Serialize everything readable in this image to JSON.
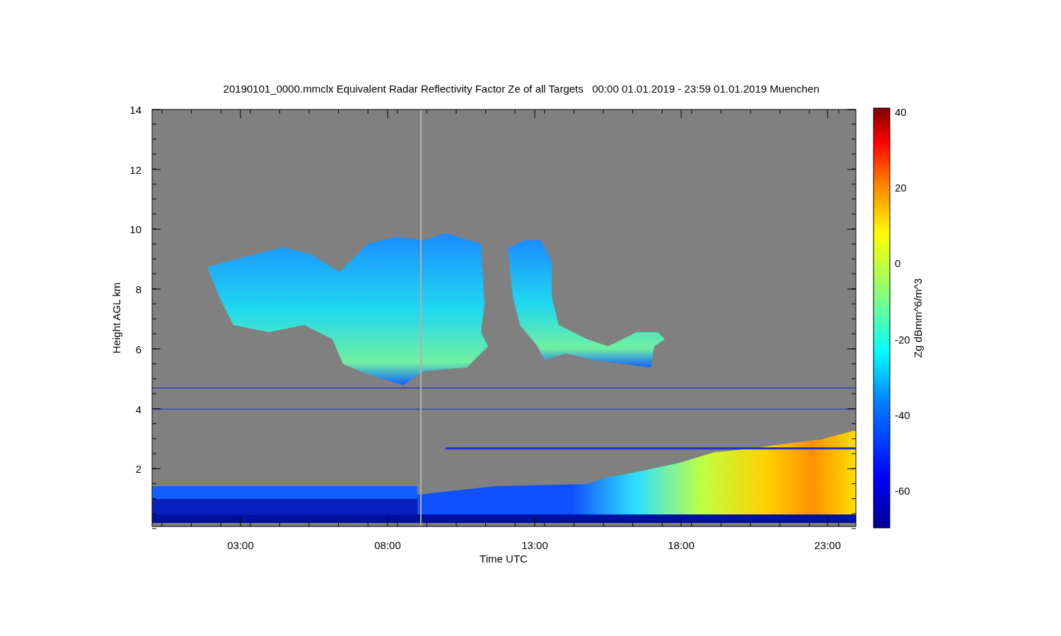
{
  "title": "20190101_0000.mmclx Equivalent Radar Reflectivity Factor Ze of all Targets   00:00 01.01.2019 - 23:59 01.01.2019 Muenchen",
  "x_axis": {
    "label": "Time UTC",
    "ticks": [
      "03:00",
      "08:00",
      "13:00",
      "18:00",
      "23:00"
    ]
  },
  "y_axis": {
    "label": "Height AGL km",
    "ticks": [
      "14",
      "12",
      "10",
      "8",
      "6",
      "4",
      "2"
    ]
  },
  "colorbar": {
    "label": "Zg dBmm^6/m^3",
    "ticks": [
      "40",
      "20",
      "0",
      "-20",
      "-40",
      "-60"
    ]
  }
}
